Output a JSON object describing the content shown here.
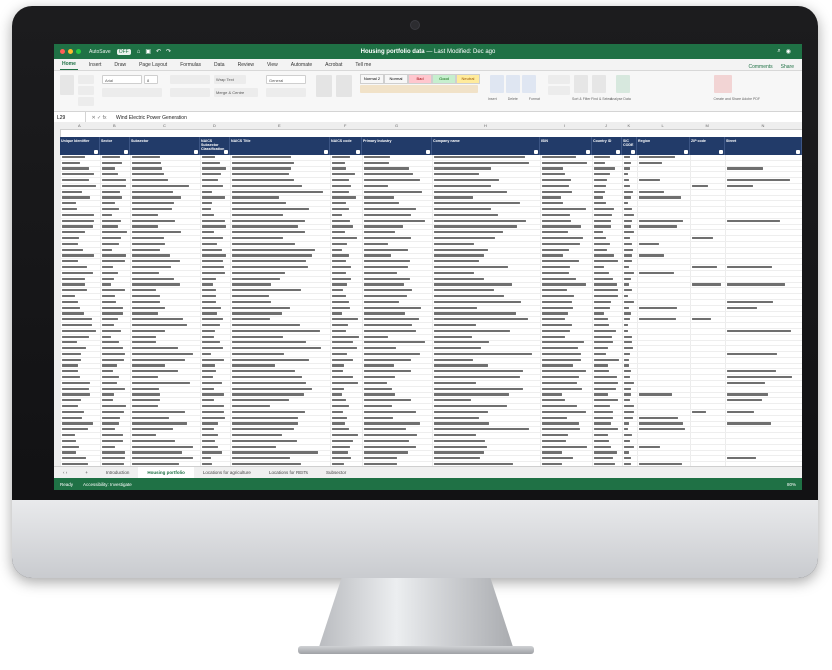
{
  "window": {
    "autosave_label": "AutoSave",
    "autosave_state": "OFF",
    "doc_title": "Housing portfolio data",
    "doc_suffix": "— Last Modified: Dec ago"
  },
  "ribbon_tabs": [
    "Home",
    "Insert",
    "Draw",
    "Page Layout",
    "Formulas",
    "Data",
    "Review",
    "View",
    "Automate",
    "Acrobat",
    "Tell me"
  ],
  "ribbon_right": [
    "Comments",
    "Share"
  ],
  "ribbon": {
    "font_name": "Arial",
    "font_size": "8",
    "wrap_label": "Wrap Text",
    "merge_label": "Merge & Centre",
    "number_format": "General",
    "styles": [
      {
        "label": "Normal 2",
        "color": "#ffffff"
      },
      {
        "label": "Normal",
        "color": "#ffffff"
      },
      {
        "label": "Bad",
        "color": "#ffc7ce"
      },
      {
        "label": "Good",
        "color": "#c6efce"
      },
      {
        "label": "Neutral",
        "color": "#ffeb9c"
      }
    ],
    "cells_labels": [
      "Insert",
      "Delete",
      "Format"
    ],
    "editing_labels": [
      "Sort & Filter",
      "Find & Select"
    ],
    "right_labels": [
      "Analyse Data",
      "Create and Share Adobe PDF"
    ]
  },
  "formula_bar": {
    "name_box": "L29",
    "content": "Wind Electric Power Generation"
  },
  "column_letters": [
    "A",
    "B",
    "C",
    "D",
    "E",
    "F",
    "G",
    "H",
    "I",
    "J",
    "K",
    "L",
    "M",
    "N"
  ],
  "table_headers": [
    "Unique Identifier",
    "Sector",
    "Subsector",
    "NAICS Subsector Classification",
    "NAICS Title",
    "NAICS code",
    "Primary Industry",
    "Company name",
    "ISIN",
    "Country ID",
    "SIC CODE",
    "Region",
    "ZIP code",
    "Street"
  ],
  "sheet_tabs": [
    "Introduction",
    "Housing portfolio",
    "Locations for agriculture",
    "Locations for REITs",
    "Subsector"
  ],
  "active_sheet_index": 1,
  "status": {
    "ready": "Ready",
    "accessibility": "Accessibility: Investigate",
    "zoom": "80%"
  },
  "colors": {
    "excel_green": "#1f7145",
    "header_navy": "#223b69"
  }
}
